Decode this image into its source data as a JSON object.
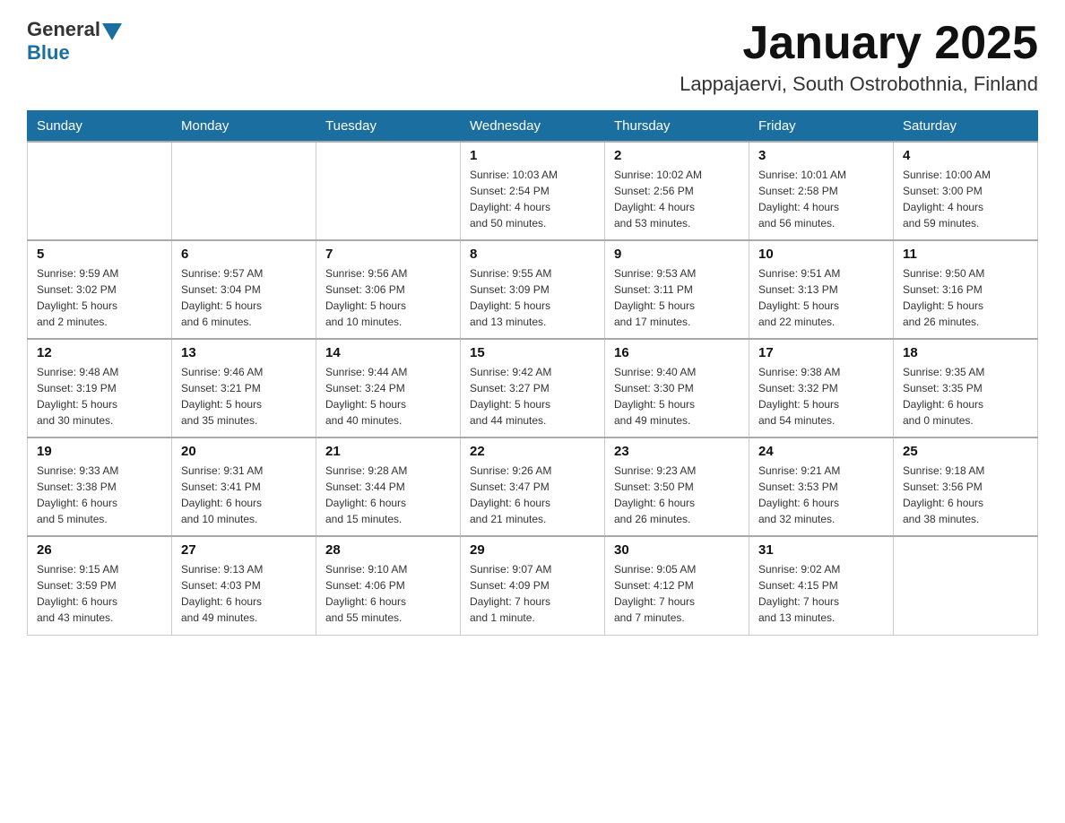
{
  "logo": {
    "general": "General",
    "blue": "Blue"
  },
  "title": "January 2025",
  "location": "Lappajaervi, South Ostrobothnia, Finland",
  "headers": [
    "Sunday",
    "Monday",
    "Tuesday",
    "Wednesday",
    "Thursday",
    "Friday",
    "Saturday"
  ],
  "weeks": [
    [
      {
        "day": "",
        "detail": ""
      },
      {
        "day": "",
        "detail": ""
      },
      {
        "day": "",
        "detail": ""
      },
      {
        "day": "1",
        "detail": "Sunrise: 10:03 AM\nSunset: 2:54 PM\nDaylight: 4 hours\nand 50 minutes."
      },
      {
        "day": "2",
        "detail": "Sunrise: 10:02 AM\nSunset: 2:56 PM\nDaylight: 4 hours\nand 53 minutes."
      },
      {
        "day": "3",
        "detail": "Sunrise: 10:01 AM\nSunset: 2:58 PM\nDaylight: 4 hours\nand 56 minutes."
      },
      {
        "day": "4",
        "detail": "Sunrise: 10:00 AM\nSunset: 3:00 PM\nDaylight: 4 hours\nand 59 minutes."
      }
    ],
    [
      {
        "day": "5",
        "detail": "Sunrise: 9:59 AM\nSunset: 3:02 PM\nDaylight: 5 hours\nand 2 minutes."
      },
      {
        "day": "6",
        "detail": "Sunrise: 9:57 AM\nSunset: 3:04 PM\nDaylight: 5 hours\nand 6 minutes."
      },
      {
        "day": "7",
        "detail": "Sunrise: 9:56 AM\nSunset: 3:06 PM\nDaylight: 5 hours\nand 10 minutes."
      },
      {
        "day": "8",
        "detail": "Sunrise: 9:55 AM\nSunset: 3:09 PM\nDaylight: 5 hours\nand 13 minutes."
      },
      {
        "day": "9",
        "detail": "Sunrise: 9:53 AM\nSunset: 3:11 PM\nDaylight: 5 hours\nand 17 minutes."
      },
      {
        "day": "10",
        "detail": "Sunrise: 9:51 AM\nSunset: 3:13 PM\nDaylight: 5 hours\nand 22 minutes."
      },
      {
        "day": "11",
        "detail": "Sunrise: 9:50 AM\nSunset: 3:16 PM\nDaylight: 5 hours\nand 26 minutes."
      }
    ],
    [
      {
        "day": "12",
        "detail": "Sunrise: 9:48 AM\nSunset: 3:19 PM\nDaylight: 5 hours\nand 30 minutes."
      },
      {
        "day": "13",
        "detail": "Sunrise: 9:46 AM\nSunset: 3:21 PM\nDaylight: 5 hours\nand 35 minutes."
      },
      {
        "day": "14",
        "detail": "Sunrise: 9:44 AM\nSunset: 3:24 PM\nDaylight: 5 hours\nand 40 minutes."
      },
      {
        "day": "15",
        "detail": "Sunrise: 9:42 AM\nSunset: 3:27 PM\nDaylight: 5 hours\nand 44 minutes."
      },
      {
        "day": "16",
        "detail": "Sunrise: 9:40 AM\nSunset: 3:30 PM\nDaylight: 5 hours\nand 49 minutes."
      },
      {
        "day": "17",
        "detail": "Sunrise: 9:38 AM\nSunset: 3:32 PM\nDaylight: 5 hours\nand 54 minutes."
      },
      {
        "day": "18",
        "detail": "Sunrise: 9:35 AM\nSunset: 3:35 PM\nDaylight: 6 hours\nand 0 minutes."
      }
    ],
    [
      {
        "day": "19",
        "detail": "Sunrise: 9:33 AM\nSunset: 3:38 PM\nDaylight: 6 hours\nand 5 minutes."
      },
      {
        "day": "20",
        "detail": "Sunrise: 9:31 AM\nSunset: 3:41 PM\nDaylight: 6 hours\nand 10 minutes."
      },
      {
        "day": "21",
        "detail": "Sunrise: 9:28 AM\nSunset: 3:44 PM\nDaylight: 6 hours\nand 15 minutes."
      },
      {
        "day": "22",
        "detail": "Sunrise: 9:26 AM\nSunset: 3:47 PM\nDaylight: 6 hours\nand 21 minutes."
      },
      {
        "day": "23",
        "detail": "Sunrise: 9:23 AM\nSunset: 3:50 PM\nDaylight: 6 hours\nand 26 minutes."
      },
      {
        "day": "24",
        "detail": "Sunrise: 9:21 AM\nSunset: 3:53 PM\nDaylight: 6 hours\nand 32 minutes."
      },
      {
        "day": "25",
        "detail": "Sunrise: 9:18 AM\nSunset: 3:56 PM\nDaylight: 6 hours\nand 38 minutes."
      }
    ],
    [
      {
        "day": "26",
        "detail": "Sunrise: 9:15 AM\nSunset: 3:59 PM\nDaylight: 6 hours\nand 43 minutes."
      },
      {
        "day": "27",
        "detail": "Sunrise: 9:13 AM\nSunset: 4:03 PM\nDaylight: 6 hours\nand 49 minutes."
      },
      {
        "day": "28",
        "detail": "Sunrise: 9:10 AM\nSunset: 4:06 PM\nDaylight: 6 hours\nand 55 minutes."
      },
      {
        "day": "29",
        "detail": "Sunrise: 9:07 AM\nSunset: 4:09 PM\nDaylight: 7 hours\nand 1 minute."
      },
      {
        "day": "30",
        "detail": "Sunrise: 9:05 AM\nSunset: 4:12 PM\nDaylight: 7 hours\nand 7 minutes."
      },
      {
        "day": "31",
        "detail": "Sunrise: 9:02 AM\nSunset: 4:15 PM\nDaylight: 7 hours\nand 13 minutes."
      },
      {
        "day": "",
        "detail": ""
      }
    ]
  ]
}
